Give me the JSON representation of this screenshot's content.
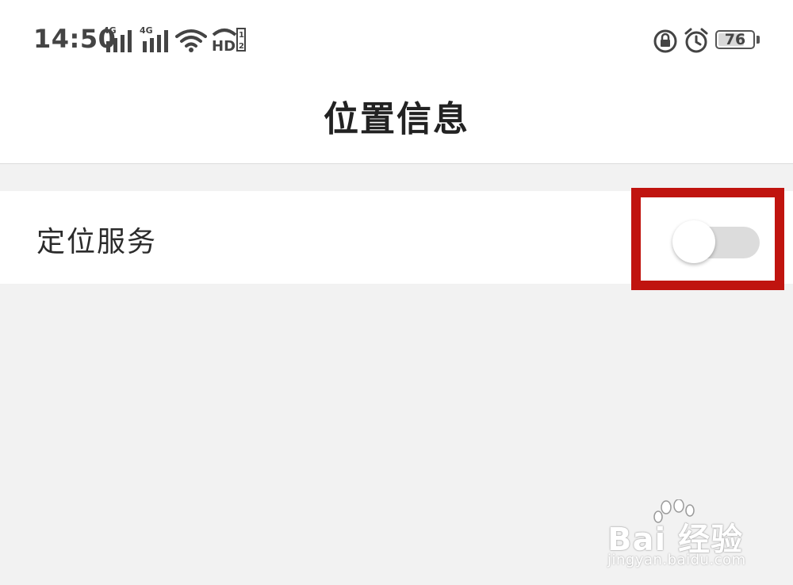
{
  "status_bar": {
    "time": "14:50",
    "sim1_network": "4G",
    "sim2_network": "4G",
    "hd_label": "HD",
    "battery_percent": 76,
    "icons": [
      "signal-icon",
      "wifi-icon",
      "hd-call-icon",
      "rotation-lock-icon",
      "alarm-icon",
      "battery-icon"
    ]
  },
  "header": {
    "title": "位置信息"
  },
  "settings": {
    "location_service": {
      "label": "定位服务",
      "enabled": false
    }
  },
  "annotation": {
    "highlight_color": "#c0140f"
  },
  "watermark": {
    "brand": "Bai 经验",
    "url": "jingyan.baidu.com"
  }
}
